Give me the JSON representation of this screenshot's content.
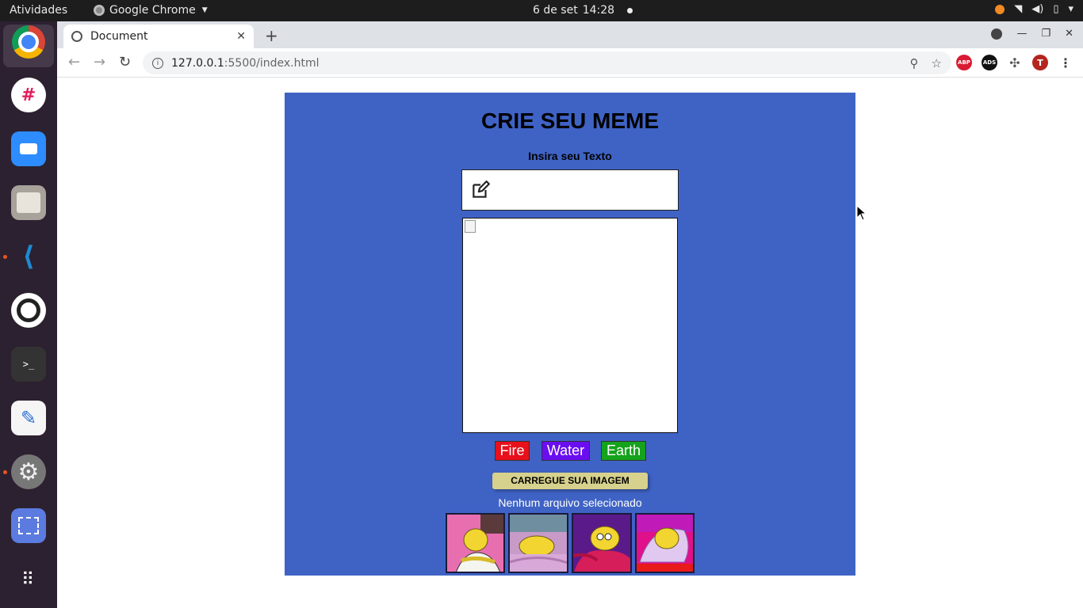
{
  "os": {
    "activities": "Atividades",
    "app_name": "Google Chrome",
    "date": "6 de set",
    "time": "14:28"
  },
  "browser": {
    "tab_title": "Document",
    "url_host": "127.0.0.1",
    "url_path": ":5500/index.html",
    "avatar_letter": "T",
    "abp_label": "ABP",
    "ads_label": "ADS"
  },
  "page": {
    "title": "CRIE SEU MEME",
    "text_label": "Insira seu Texto",
    "text_input_value": "",
    "meme_text": "",
    "borders": [
      {
        "label": "Fire",
        "color": "#e8101a"
      },
      {
        "label": "Water",
        "color": "#6a0ef0"
      },
      {
        "label": "Earth",
        "color": "#15a21c"
      }
    ],
    "upload_label": "CARREGUE SUA IMAGEM",
    "file_status": "Nenhum arquivo selecionado",
    "background_color": "#3f63c5"
  },
  "dock": {
    "items": [
      "chrome-icon",
      "slack-icon",
      "zoom-icon",
      "files-icon",
      "vscode-icon",
      "obs-icon",
      "terminal-icon",
      "text-editor-icon",
      "settings-icon",
      "screenshot-icon",
      "app-grid-icon"
    ]
  }
}
